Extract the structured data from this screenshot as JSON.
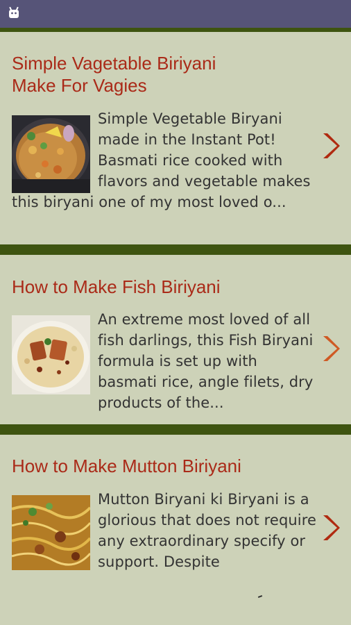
{
  "status_bar": {
    "icon": "android-icon"
  },
  "colors": {
    "status_bar": "#565478",
    "background": "#cdd2b8",
    "divider": "#3e5410",
    "title": "#aa2a18",
    "chevron": "#b02a10",
    "text": "#333333"
  },
  "recipes": [
    {
      "title_line1": "Simple Vagetable Biriyani",
      "title_line2": "Make For Vagies",
      "description": "Simple Vegetable Biryani made in the Instant Pot! Basmati rice cooked with flavors and vegetable makes this biryani one of my most loved o...",
      "image": "vegetable-biryani-image",
      "action_icon": "chevron-right-icon"
    },
    {
      "title_line1": "How to Make Fish Biriyani",
      "description": " An extreme most loved of all fish darlings, this Fish Biryani formula is set up with basmati rice, angle filets, dry products of the...",
      "image": "fish-biryani-image",
      "action_icon": "chevron-right-icon"
    },
    {
      "title_line1": "How to Make Mutton Biriyani",
      "description": "Mutton Biryani ki Biryani is a glorious  that does not require any extraordinary specify or support. Despite",
      "image": "mutton-biryani-image",
      "action_icon": "chevron-right-icon"
    }
  ]
}
